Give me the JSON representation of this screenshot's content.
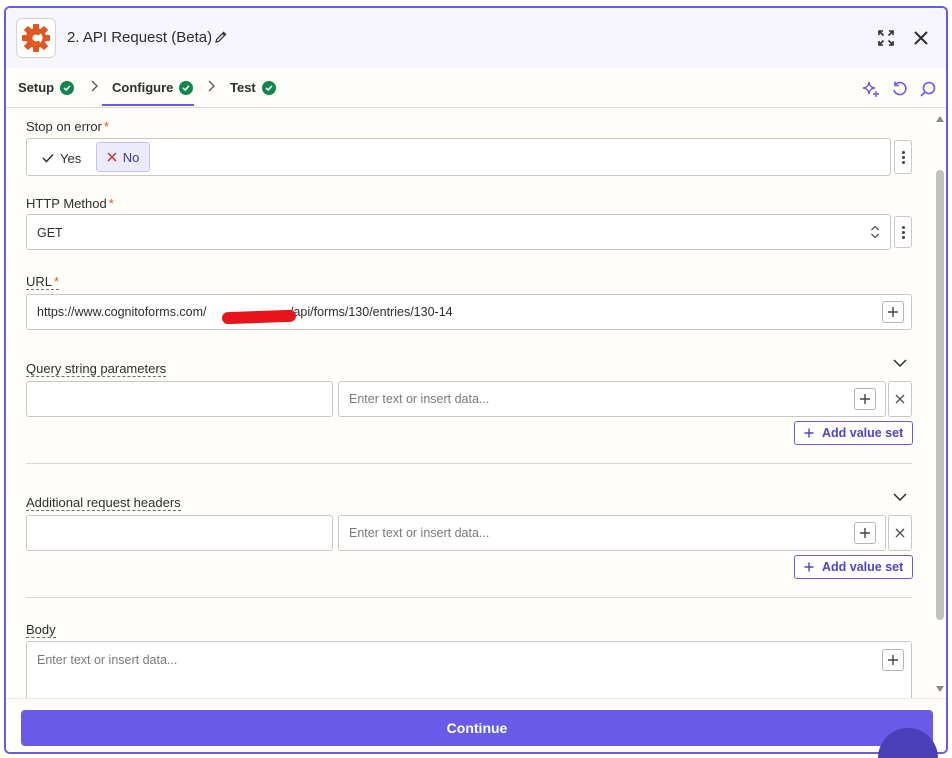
{
  "header": {
    "title": "2. API Request (Beta)",
    "logo_icon": "cognito-forms-logo",
    "brand_color": "#e0561f"
  },
  "tabs": [
    {
      "label": "Setup",
      "status": "complete"
    },
    {
      "label": "Configure",
      "status": "complete",
      "active": true
    },
    {
      "label": "Test",
      "status": "complete"
    }
  ],
  "fields": {
    "stop_on_error": {
      "label": "Stop on error",
      "required": "*",
      "yes_label": "Yes",
      "no_label": "No",
      "selected": "No"
    },
    "http_method": {
      "label": "HTTP Method",
      "required": "*",
      "value": "GET"
    },
    "url": {
      "label": "URL",
      "required": "*",
      "value_prefix": "https://www.cognitoforms.com/",
      "value_suffix": "/api/forms/130/entries/130-14"
    },
    "query_params": {
      "label": "Query string parameters",
      "value_placeholder": "Enter text or insert data...",
      "add_label": "Add value set"
    },
    "headers": {
      "label": "Additional request headers",
      "value_placeholder": "Enter text or insert data...",
      "add_label": "Add value set"
    },
    "body": {
      "label": "Body",
      "placeholder": "Enter text or insert data..."
    }
  },
  "footer": {
    "continue_label": "Continue",
    "accent": "#695be8"
  }
}
